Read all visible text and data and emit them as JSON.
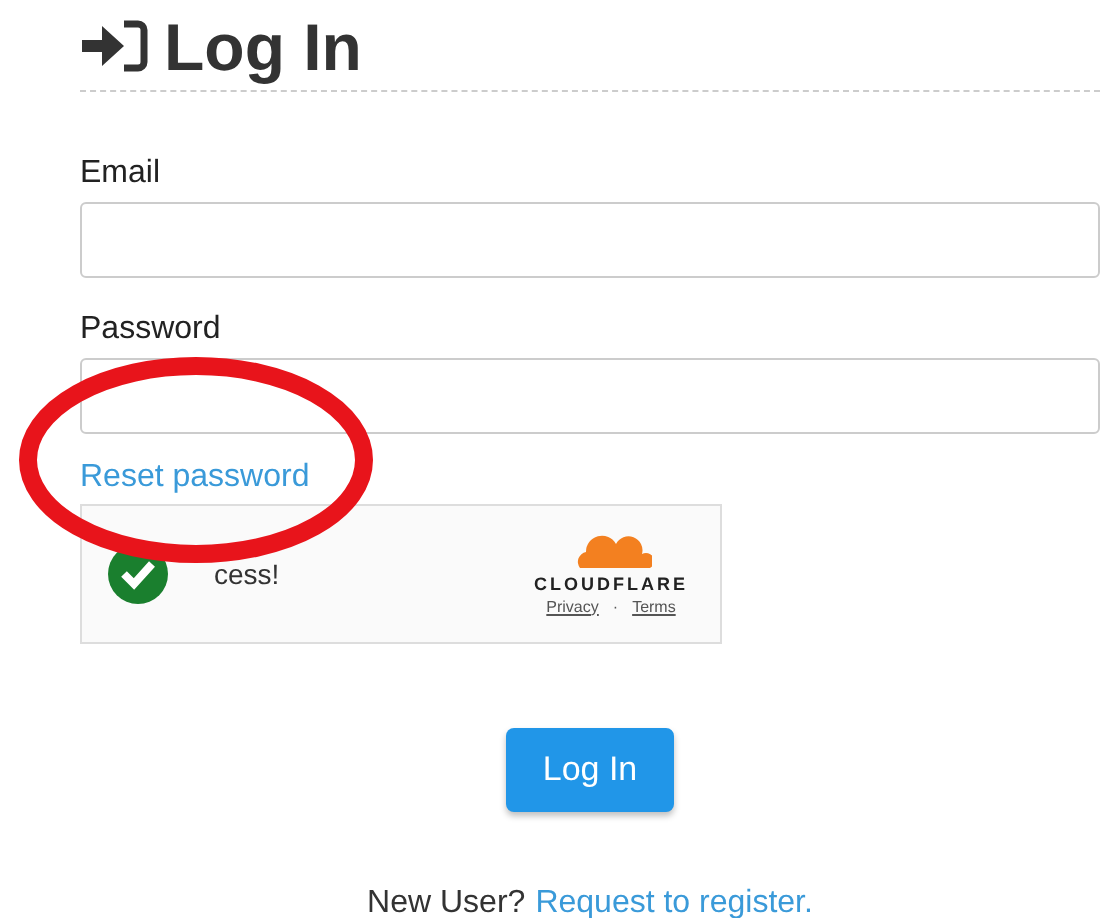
{
  "title": "Log In",
  "fields": [
    {
      "label": "Email"
    },
    {
      "label": "Password"
    }
  ],
  "reset_link": "Reset password",
  "captcha": {
    "status": "cess!",
    "success": true,
    "brand": "CLOUDFLARE",
    "links": [
      "Privacy",
      "Terms"
    ],
    "separator": "·"
  },
  "submit": "Log In",
  "footer": {
    "text": "New User?",
    "link": "Request to register."
  },
  "annotation": {
    "kind": "ellipse"
  }
}
